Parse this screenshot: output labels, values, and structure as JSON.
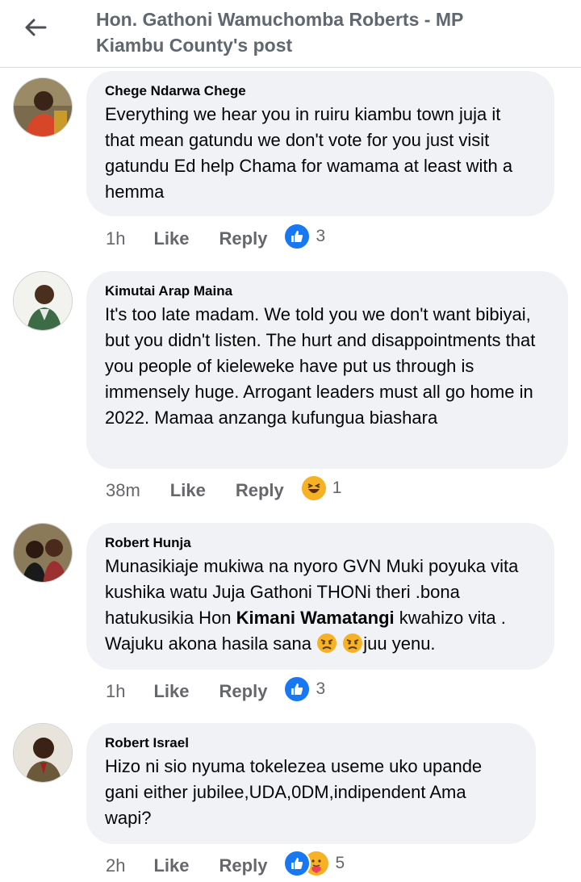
{
  "header": {
    "title_line1": "Hon. Gathoni Wamuchomba Roberts - MP",
    "title_line2": "Kiambu County's post"
  },
  "comments": [
    {
      "author": "Chege Ndarwa Chege",
      "text": "Everything we hear you in ruiru kiambu town juja it that mean gatundu we don't vote for you just visit gatundu Ed help Chama for wamama at least with a hemma",
      "time": "1h",
      "like_label": "Like",
      "reply_label": "Reply",
      "reactions": [
        "like-icon"
      ],
      "reaction_count": "3"
    },
    {
      "author": "Kimutai Arap Maina",
      "text": "It's too late madam. We told you we don't want bibiyai, but you didn't listen. The hurt and disappointments that you people of kieleweke have put us through is immensely huge. Arrogant leaders must all go home in 2022. Mamaa anzanga kufungua biashara",
      "time": "38m",
      "like_label": "Like",
      "reply_label": "Reply",
      "reactions": [
        "haha-icon"
      ],
      "reaction_count": "1"
    },
    {
      "author": "Robert Hunja",
      "text_before": "Munasikiaje mukiwa na nyoro GVN Muki poyuka vita kushika watu Juja Gathoni THONi theri .bona hatukusikia Hon ",
      "text_bold": "Kimani Wamatangi",
      "text_after": " kwahizo vita . Wajuku akona hasila sana ",
      "text_tail": "juu yenu.",
      "inline_emojis": [
        "angry-face-icon",
        "angry-face-icon"
      ],
      "time": "1h",
      "like_label": "Like",
      "reply_label": "Reply",
      "reactions": [
        "like-icon"
      ],
      "reaction_count": "3"
    },
    {
      "author": "Robert Israel",
      "text": "Hizo ni sio nyuma tokelezea useme uko upande gani either jubilee,UDA,0DM,indipendent Ama wapi?",
      "time": "2h",
      "like_label": "Like",
      "reply_label": "Reply",
      "reactions": [
        "like-icon",
        "care-icon"
      ],
      "reaction_count": "5"
    }
  ],
  "colors": {
    "bubble": "#f0f2f5",
    "meta": "#65676b",
    "like_blue": "#1877f2",
    "haha_yellow": "#f7b125"
  }
}
